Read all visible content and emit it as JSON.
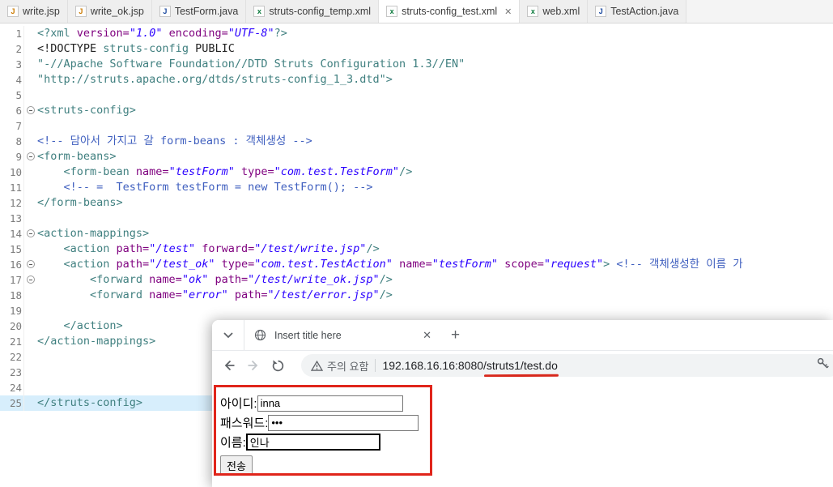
{
  "colors": {
    "xml_tag": "#3F7F7F",
    "xml_attr": "#7F007F",
    "xml_value": "#2A00FF",
    "xml_comment": "#3F5FBF",
    "current_line_highlight": "#D7EEFC",
    "annotation_red": "#E0251B"
  },
  "ide": {
    "tabs": [
      {
        "label": "write.jsp",
        "icon": "jsp",
        "active": false
      },
      {
        "label": "write_ok.jsp",
        "icon": "jsp",
        "active": false
      },
      {
        "label": "TestForm.java",
        "icon": "java",
        "active": false
      },
      {
        "label": "struts-config_temp.xml",
        "icon": "xml",
        "active": false
      },
      {
        "label": "struts-config_test.xml",
        "icon": "xml",
        "active": true,
        "close_glyph": "✕"
      },
      {
        "label": "web.xml",
        "icon": "xml",
        "active": false
      },
      {
        "label": "TestAction.java",
        "icon": "java",
        "active": false
      }
    ],
    "editor": {
      "lines": [
        {
          "n": 1,
          "segs": [
            [
              "tg",
              "<?xml "
            ],
            [
              "at",
              "version="
            ],
            [
              "vl",
              "\"1.0\""
            ],
            [
              "pl",
              " "
            ],
            [
              "at",
              "encoding="
            ],
            [
              "vl",
              "\"UTF-8\""
            ],
            [
              "tg",
              "?>"
            ]
          ]
        },
        {
          "n": 2,
          "segs": [
            [
              "pl",
              "<!DOCTYPE "
            ],
            [
              "tg",
              "struts-config "
            ],
            [
              "pl",
              "PUBLIC"
            ]
          ]
        },
        {
          "n": 3,
          "segs": [
            [
              "tg",
              "\"-//Apache Software Foundation//DTD Struts Configuration 1.3//EN\""
            ]
          ]
        },
        {
          "n": 4,
          "segs": [
            [
              "tg",
              "\"http://struts.apache.org/dtds/struts-config_1_3.dtd\">"
            ]
          ]
        },
        {
          "n": 5,
          "segs": []
        },
        {
          "n": 6,
          "fold": true,
          "segs": [
            [
              "tg",
              "<struts-config>"
            ]
          ]
        },
        {
          "n": 7,
          "segs": []
        },
        {
          "n": 8,
          "segs": [
            [
              "cm",
              "<!-- 담아서 가지고 갈 form-beans : 객체생성 -->"
            ]
          ]
        },
        {
          "n": 9,
          "fold": true,
          "segs": [
            [
              "tg",
              "<form-beans>"
            ]
          ]
        },
        {
          "n": 10,
          "segs": [
            [
              "tg",
              "    <form-bean "
            ],
            [
              "at",
              "name="
            ],
            [
              "vl",
              "\"testForm\""
            ],
            [
              "pl",
              " "
            ],
            [
              "at",
              "type="
            ],
            [
              "vl",
              "\"com.test.TestForm\""
            ],
            [
              "tg",
              "/>"
            ]
          ]
        },
        {
          "n": 11,
          "segs": [
            [
              "cm",
              "    <!-- =  TestForm testForm = new TestForm(); -->"
            ]
          ]
        },
        {
          "n": 12,
          "segs": [
            [
              "tg",
              "</form-beans>"
            ]
          ]
        },
        {
          "n": 13,
          "segs": []
        },
        {
          "n": 14,
          "fold": true,
          "segs": [
            [
              "tg",
              "<action-mappings>"
            ]
          ]
        },
        {
          "n": 15,
          "segs": [
            [
              "tg",
              "    <action "
            ],
            [
              "at",
              "path="
            ],
            [
              "vl",
              "\"/test\""
            ],
            [
              "pl",
              " "
            ],
            [
              "at",
              "forward="
            ],
            [
              "vl",
              "\"/test/write.jsp\""
            ],
            [
              "tg",
              "/>"
            ]
          ]
        },
        {
          "n": 16,
          "fold": true,
          "segs": [
            [
              "tg",
              "    <action "
            ],
            [
              "at",
              "path="
            ],
            [
              "vl",
              "\"/test_ok\""
            ],
            [
              "pl",
              " "
            ],
            [
              "at",
              "type="
            ],
            [
              "vl",
              "\"com.test.TestAction\""
            ],
            [
              "pl",
              " "
            ],
            [
              "at",
              "name="
            ],
            [
              "vl",
              "\"testForm\""
            ],
            [
              "pl",
              " "
            ],
            [
              "at",
              "scope="
            ],
            [
              "vl",
              "\"request\""
            ],
            [
              "tg",
              ">"
            ],
            [
              "pl",
              " "
            ],
            [
              "cm",
              "<!-- 객체생성한 이름 가"
            ]
          ]
        },
        {
          "n": 17,
          "fold": true,
          "segs": [
            [
              "tg",
              "        <forward "
            ],
            [
              "at",
              "name="
            ],
            [
              "vl",
              "\"ok\""
            ],
            [
              "pl",
              " "
            ],
            [
              "at",
              "path="
            ],
            [
              "vl",
              "\"/test/write_ok.jsp\""
            ],
            [
              "tg",
              "/>"
            ]
          ]
        },
        {
          "n": 18,
          "segs": [
            [
              "tg",
              "        <forward "
            ],
            [
              "at",
              "name="
            ],
            [
              "vl",
              "\"error\""
            ],
            [
              "pl",
              " "
            ],
            [
              "at",
              "path="
            ],
            [
              "vl",
              "\"/test/error.jsp\""
            ],
            [
              "tg",
              "/>"
            ]
          ]
        },
        {
          "n": 19,
          "segs": []
        },
        {
          "n": 20,
          "segs": [
            [
              "tg",
              "    </action>"
            ]
          ]
        },
        {
          "n": 21,
          "segs": [
            [
              "tg",
              "</action-mappings>"
            ]
          ]
        },
        {
          "n": 22,
          "segs": []
        },
        {
          "n": 23,
          "segs": []
        },
        {
          "n": 24,
          "segs": []
        },
        {
          "n": 25,
          "current": true,
          "segs": [
            [
              "tg",
              "</struts-config>"
            ]
          ]
        }
      ]
    }
  },
  "browser": {
    "tab_title": "Insert title here",
    "tab_close_glyph": "✕",
    "new_tab_glyph": "+",
    "security_chip": "주의 요함",
    "url_prefix": "192.168.16.16:8080/",
    "url_underlined": "struts1/test.do",
    "form": {
      "id_label": "아이디:",
      "id_value": "inna",
      "pw_label": "패스워드:",
      "pw_value": "•••",
      "name_label": "이름:",
      "name_value": "인나",
      "submit_label": "전송"
    }
  }
}
